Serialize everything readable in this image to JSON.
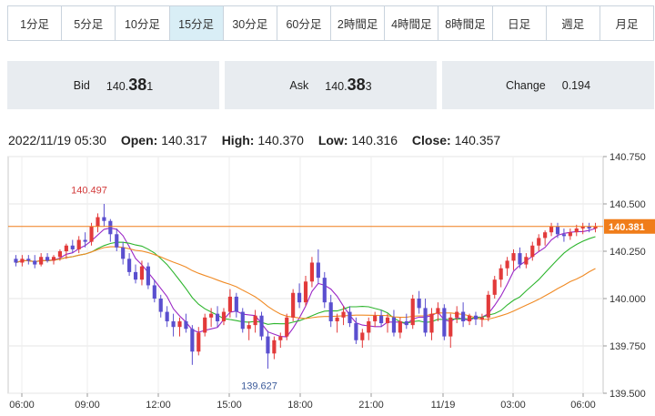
{
  "tabs": [
    {
      "label": "1分足",
      "active": false
    },
    {
      "label": "5分足",
      "active": false
    },
    {
      "label": "10分足",
      "active": false
    },
    {
      "label": "15分足",
      "active": true
    },
    {
      "label": "30分足",
      "active": false
    },
    {
      "label": "60分足",
      "active": false
    },
    {
      "label": "2時間足",
      "active": false
    },
    {
      "label": "4時間足",
      "active": false
    },
    {
      "label": "8時間足",
      "active": false
    },
    {
      "label": "日足",
      "active": false
    },
    {
      "label": "週足",
      "active": false
    },
    {
      "label": "月足",
      "active": false
    }
  ],
  "quote": {
    "bid_label": "Bid",
    "bid_main": "140.",
    "bid_big": "38",
    "bid_tail": "1",
    "ask_label": "Ask",
    "ask_main": "140.",
    "ask_big": "38",
    "ask_tail": "3",
    "change_label": "Change",
    "change_value": "0.194"
  },
  "ohlc": {
    "datetime": "2022/11/19 05:30",
    "open_label": "Open:",
    "open": "140.317",
    "high_label": "High:",
    "high": "140.370",
    "low_label": "Low:",
    "low": "140.316",
    "close_label": "Close:",
    "close": "140.357"
  },
  "colors": {
    "up": "#e23a3a",
    "down": "#5a4fcf",
    "ma_short": "#9b27c6",
    "ma_mid": "#2db52d",
    "ma_long": "#f08a24",
    "price_line": "#f07d1a",
    "price_tag": "#f07d1a",
    "high_label": "#d23a3a",
    "low_label": "#3b5a9a"
  },
  "chart_data": {
    "type": "candlestick",
    "ylim": [
      139.5,
      140.75
    ],
    "y_ticks": [
      "140.750",
      "140.500",
      "140.250",
      "140.000",
      "139.750",
      "139.500"
    ],
    "x_ticks": [
      "06:00",
      "09:00",
      "12:00",
      "15:00",
      "18:00",
      "21:00",
      "11/19",
      "03:00",
      "06:00"
    ],
    "current_price": "140.381",
    "current_price_value": 140.381,
    "high_annotation": {
      "label": "140.497",
      "value": 140.497
    },
    "low_annotation": {
      "label": "139.627",
      "value": 139.627
    },
    "candles": [
      [
        140.21,
        140.23,
        140.17,
        140.19
      ],
      [
        140.19,
        140.23,
        140.17,
        140.21
      ],
      [
        140.21,
        140.23,
        140.18,
        140.2
      ],
      [
        140.2,
        140.23,
        140.16,
        140.18
      ],
      [
        140.18,
        140.24,
        140.17,
        140.22
      ],
      [
        140.22,
        140.24,
        140.19,
        140.2
      ],
      [
        140.2,
        140.23,
        140.18,
        140.22
      ],
      [
        140.22,
        140.26,
        140.2,
        140.25
      ],
      [
        140.25,
        140.29,
        140.21,
        140.28
      ],
      [
        140.28,
        140.31,
        140.24,
        140.26
      ],
      [
        140.26,
        140.33,
        140.24,
        140.31
      ],
      [
        140.31,
        140.35,
        140.27,
        140.3
      ],
      [
        140.3,
        140.4,
        140.28,
        140.38
      ],
      [
        140.38,
        140.45,
        140.35,
        140.43
      ],
      [
        140.43,
        140.5,
        140.38,
        140.41
      ],
      [
        140.41,
        140.42,
        140.3,
        140.34
      ],
      [
        140.34,
        140.37,
        140.25,
        140.27
      ],
      [
        140.27,
        140.3,
        140.18,
        140.21
      ],
      [
        140.21,
        140.24,
        140.12,
        140.14
      ],
      [
        140.14,
        140.18,
        140.08,
        140.1
      ],
      [
        140.1,
        140.2,
        140.07,
        140.17
      ],
      [
        140.17,
        140.19,
        140.05,
        140.07
      ],
      [
        140.07,
        140.1,
        139.98,
        140.0
      ],
      [
        140.0,
        140.02,
        139.9,
        139.93
      ],
      [
        139.93,
        139.96,
        139.85,
        139.88
      ],
      [
        139.88,
        139.92,
        139.8,
        139.85
      ],
      [
        139.85,
        139.9,
        139.8,
        139.88
      ],
      [
        139.88,
        139.92,
        139.82,
        139.84
      ],
      [
        139.84,
        139.86,
        139.65,
        139.72
      ],
      [
        139.72,
        139.85,
        139.7,
        139.82
      ],
      [
        139.82,
        139.92,
        139.8,
        139.9
      ],
      [
        139.9,
        139.95,
        139.85,
        139.92
      ],
      [
        139.92,
        139.96,
        139.85,
        139.88
      ],
      [
        139.88,
        139.95,
        139.86,
        139.93
      ],
      [
        139.93,
        140.05,
        139.9,
        140.01
      ],
      [
        140.01,
        140.03,
        139.9,
        139.93
      ],
      [
        139.93,
        139.95,
        139.82,
        139.84
      ],
      [
        139.84,
        139.88,
        139.78,
        139.86
      ],
      [
        139.86,
        139.94,
        139.82,
        139.91
      ],
      [
        139.91,
        139.93,
        139.78,
        139.8
      ],
      [
        139.8,
        139.83,
        139.63,
        139.71
      ],
      [
        139.71,
        139.8,
        139.68,
        139.78
      ],
      [
        139.78,
        139.82,
        139.74,
        139.8
      ],
      [
        139.8,
        139.92,
        139.78,
        139.9
      ],
      [
        139.9,
        140.05,
        139.88,
        140.03
      ],
      [
        140.03,
        140.08,
        139.95,
        139.98
      ],
      [
        139.98,
        140.12,
        139.96,
        140.09
      ],
      [
        140.09,
        140.22,
        140.06,
        140.19
      ],
      [
        140.19,
        140.26,
        140.08,
        140.11
      ],
      [
        140.11,
        140.14,
        139.95,
        139.98
      ],
      [
        139.98,
        140.02,
        139.85,
        139.88
      ],
      [
        139.88,
        139.92,
        139.82,
        139.9
      ],
      [
        139.9,
        139.96,
        139.86,
        139.93
      ],
      [
        139.93,
        139.96,
        139.85,
        139.87
      ],
      [
        139.87,
        139.9,
        139.76,
        139.78
      ],
      [
        139.78,
        139.84,
        139.74,
        139.82
      ],
      [
        139.82,
        139.9,
        139.78,
        139.88
      ],
      [
        139.88,
        139.93,
        139.85,
        139.91
      ],
      [
        139.91,
        139.94,
        139.85,
        139.87
      ],
      [
        139.87,
        139.92,
        139.82,
        139.9
      ],
      [
        139.9,
        139.94,
        139.8,
        139.82
      ],
      [
        139.82,
        139.9,
        139.79,
        139.88
      ],
      [
        139.88,
        139.92,
        139.84,
        139.86
      ],
      [
        139.86,
        140.02,
        139.84,
        140.0
      ],
      [
        140.0,
        140.04,
        139.92,
        139.95
      ],
      [
        139.95,
        140.0,
        139.8,
        139.82
      ],
      [
        139.82,
        139.95,
        139.78,
        139.92
      ],
      [
        139.92,
        139.98,
        139.88,
        139.95
      ],
      [
        139.95,
        139.97,
        139.78,
        139.8
      ],
      [
        139.8,
        139.92,
        139.74,
        139.9
      ],
      [
        139.9,
        139.96,
        139.87,
        139.93
      ],
      [
        139.93,
        139.98,
        139.85,
        139.88
      ],
      [
        139.88,
        139.92,
        139.86,
        139.91
      ],
      [
        139.91,
        139.93,
        139.86,
        139.89
      ],
      [
        139.89,
        139.92,
        139.85,
        139.9
      ],
      [
        139.9,
        140.04,
        139.88,
        140.02
      ],
      [
        140.02,
        140.12,
        140.0,
        140.1
      ],
      [
        140.1,
        140.18,
        140.06,
        140.16
      ],
      [
        140.16,
        140.22,
        140.12,
        140.2
      ],
      [
        140.2,
        140.26,
        140.15,
        140.24
      ],
      [
        140.24,
        140.27,
        140.16,
        140.18
      ],
      [
        140.18,
        140.24,
        140.16,
        140.22
      ],
      [
        140.22,
        140.3,
        140.2,
        140.28
      ],
      [
        140.28,
        140.34,
        140.25,
        140.32
      ],
      [
        140.32,
        140.36,
        140.28,
        140.35
      ],
      [
        140.35,
        140.4,
        140.33,
        140.38
      ],
      [
        140.38,
        140.4,
        140.32,
        140.34
      ],
      [
        140.34,
        140.37,
        140.3,
        140.33
      ],
      [
        140.33,
        140.37,
        140.31,
        140.35
      ],
      [
        140.35,
        140.39,
        140.33,
        140.37
      ],
      [
        140.37,
        140.4,
        140.34,
        140.38
      ],
      [
        140.38,
        140.4,
        140.35,
        140.37
      ],
      [
        140.37,
        140.4,
        140.35,
        140.38
      ]
    ]
  }
}
